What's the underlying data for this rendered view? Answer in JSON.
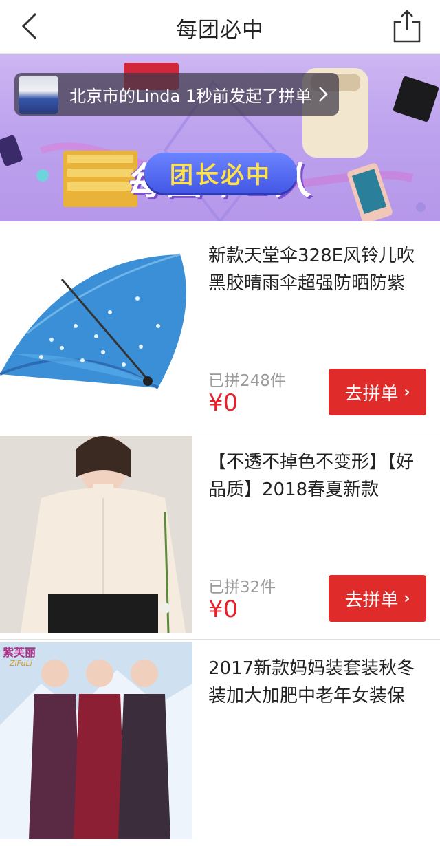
{
  "header": {
    "title": "每团必中"
  },
  "banner": {
    "headline": "每团中2人",
    "pill": "团长必中",
    "notice": "北京市的Linda 1秒前发起了拼单"
  },
  "products": [
    {
      "title": "新款天堂伞328E风铃儿吹黑胶晴雨伞超强防晒防紫",
      "sold": "已拼248件",
      "price": "¥0",
      "button": "去拼单",
      "image": "blue-umbrella"
    },
    {
      "title": "【不透不掉色不变形】【好品质】2018春夏新款",
      "sold": "已拼32件",
      "price": "¥0",
      "button": "去拼单",
      "image": "white-blouse"
    },
    {
      "title": "2017新款妈妈装套装秋冬装加大加肥中老年女装保",
      "image": "mother-jackets",
      "brand": "紫芙丽 ZiFuLi"
    }
  ],
  "colors": {
    "accent": "#e02b2b",
    "price": "#e8202a",
    "banner": "#bda3ee"
  }
}
